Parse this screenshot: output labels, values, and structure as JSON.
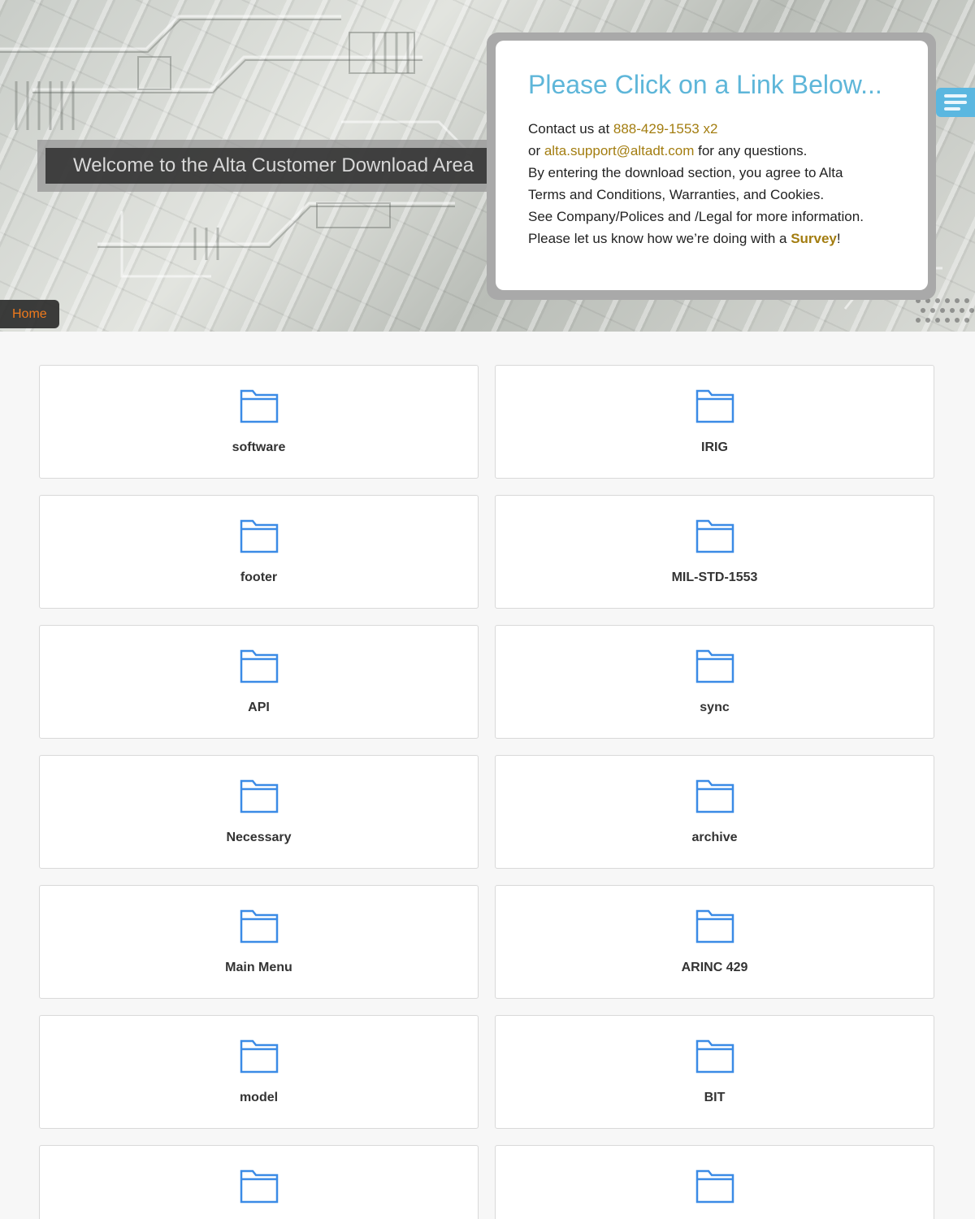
{
  "hero": {
    "welcome_text": "Welcome to the Alta Customer Download Area",
    "breadcrumb_home": "Home",
    "menu_icon": "hamburger-menu-icon"
  },
  "info": {
    "title": "Please Click on a Link Below...",
    "contact_prefix": "Contact us at ",
    "phone": "888-429-1553 x2",
    "or_prefix": "or ",
    "email": "alta.support@altadt.com",
    "email_suffix": " for any questions.",
    "line3": "By entering the download section, you agree to Alta",
    "line4": "Terms and Conditions, Warranties, and Cookies.",
    "line5": "See Company/Polices and /Legal for more information.",
    "survey_prefix": "Please let us know how we’re doing with a ",
    "survey_link": "Survey",
    "survey_suffix": "!"
  },
  "colors": {
    "accent_blue": "#5eb6d9",
    "link_gold": "#a37d10",
    "home_orange": "#f07a1c",
    "folder_blue": "#3b8be6"
  },
  "folders": [
    {
      "label": "software",
      "icon": "folder-icon"
    },
    {
      "label": "IRIG",
      "icon": "folder-icon"
    },
    {
      "label": "footer",
      "icon": "folder-icon"
    },
    {
      "label": "MIL-STD-1553",
      "icon": "folder-icon"
    },
    {
      "label": "API",
      "icon": "folder-icon"
    },
    {
      "label": "sync",
      "icon": "folder-icon"
    },
    {
      "label": "Necessary",
      "icon": "folder-icon"
    },
    {
      "label": "archive",
      "icon": "folder-icon"
    },
    {
      "label": "Main Menu",
      "icon": "folder-icon"
    },
    {
      "label": "ARINC 429",
      "icon": "folder-icon"
    },
    {
      "label": "model",
      "icon": "folder-icon"
    },
    {
      "label": "BIT",
      "icon": "folder-icon"
    },
    {
      "label": "",
      "icon": "folder-icon"
    },
    {
      "label": "",
      "icon": "folder-icon"
    }
  ]
}
